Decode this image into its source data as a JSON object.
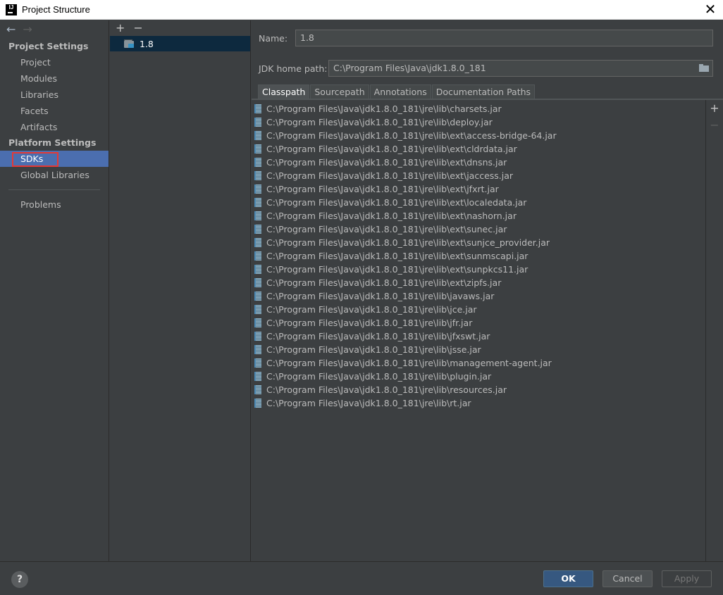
{
  "window": {
    "title": "Project Structure",
    "app_icon": "IJ",
    "close_icon": "close-icon"
  },
  "nav": {
    "back_icon": "←",
    "forward_icon": "→",
    "project_settings_heading": "Project Settings",
    "project_items": [
      "Project",
      "Modules",
      "Libraries",
      "Facets",
      "Artifacts"
    ],
    "platform_settings_heading": "Platform Settings",
    "platform_items": [
      "SDKs",
      "Global Libraries"
    ],
    "selected_item": "SDKs",
    "problems": "Problems"
  },
  "tree": {
    "add_icon": "+",
    "remove_icon": "−",
    "items": [
      "1.8"
    ]
  },
  "sdk": {
    "name_label": "Name:",
    "name_value": "1.8",
    "home_label": "JDK home path:",
    "home_value": "C:\\Program Files\\Java\\jdk1.8.0_181"
  },
  "tabs": [
    "Classpath",
    "Sourcepath",
    "Annotations",
    "Documentation Paths"
  ],
  "active_tab": "Classpath",
  "classpath": [
    "C:\\Program Files\\Java\\jdk1.8.0_181\\jre\\lib\\charsets.jar",
    "C:\\Program Files\\Java\\jdk1.8.0_181\\jre\\lib\\deploy.jar",
    "C:\\Program Files\\Java\\jdk1.8.0_181\\jre\\lib\\ext\\access-bridge-64.jar",
    "C:\\Program Files\\Java\\jdk1.8.0_181\\jre\\lib\\ext\\cldrdata.jar",
    "C:\\Program Files\\Java\\jdk1.8.0_181\\jre\\lib\\ext\\dnsns.jar",
    "C:\\Program Files\\Java\\jdk1.8.0_181\\jre\\lib\\ext\\jaccess.jar",
    "C:\\Program Files\\Java\\jdk1.8.0_181\\jre\\lib\\ext\\jfxrt.jar",
    "C:\\Program Files\\Java\\jdk1.8.0_181\\jre\\lib\\ext\\localedata.jar",
    "C:\\Program Files\\Java\\jdk1.8.0_181\\jre\\lib\\ext\\nashorn.jar",
    "C:\\Program Files\\Java\\jdk1.8.0_181\\jre\\lib\\ext\\sunec.jar",
    "C:\\Program Files\\Java\\jdk1.8.0_181\\jre\\lib\\ext\\sunjce_provider.jar",
    "C:\\Program Files\\Java\\jdk1.8.0_181\\jre\\lib\\ext\\sunmscapi.jar",
    "C:\\Program Files\\Java\\jdk1.8.0_181\\jre\\lib\\ext\\sunpkcs11.jar",
    "C:\\Program Files\\Java\\jdk1.8.0_181\\jre\\lib\\ext\\zipfs.jar",
    "C:\\Program Files\\Java\\jdk1.8.0_181\\jre\\lib\\javaws.jar",
    "C:\\Program Files\\Java\\jdk1.8.0_181\\jre\\lib\\jce.jar",
    "C:\\Program Files\\Java\\jdk1.8.0_181\\jre\\lib\\jfr.jar",
    "C:\\Program Files\\Java\\jdk1.8.0_181\\jre\\lib\\jfxswt.jar",
    "C:\\Program Files\\Java\\jdk1.8.0_181\\jre\\lib\\jsse.jar",
    "C:\\Program Files\\Java\\jdk1.8.0_181\\jre\\lib\\management-agent.jar",
    "C:\\Program Files\\Java\\jdk1.8.0_181\\jre\\lib\\plugin.jar",
    "C:\\Program Files\\Java\\jdk1.8.0_181\\jre\\lib\\resources.jar",
    "C:\\Program Files\\Java\\jdk1.8.0_181\\jre\\lib\\rt.jar"
  ],
  "side_toolbar": {
    "add_icon": "+",
    "remove_icon": "−"
  },
  "buttons": {
    "help": "?",
    "ok": "OK",
    "cancel": "Cancel",
    "apply": "Apply"
  },
  "colors": {
    "background": "#3c3f41",
    "selection": "#4b6eaf",
    "highlight_outline": "#e53935",
    "primary_button": "#365880"
  }
}
